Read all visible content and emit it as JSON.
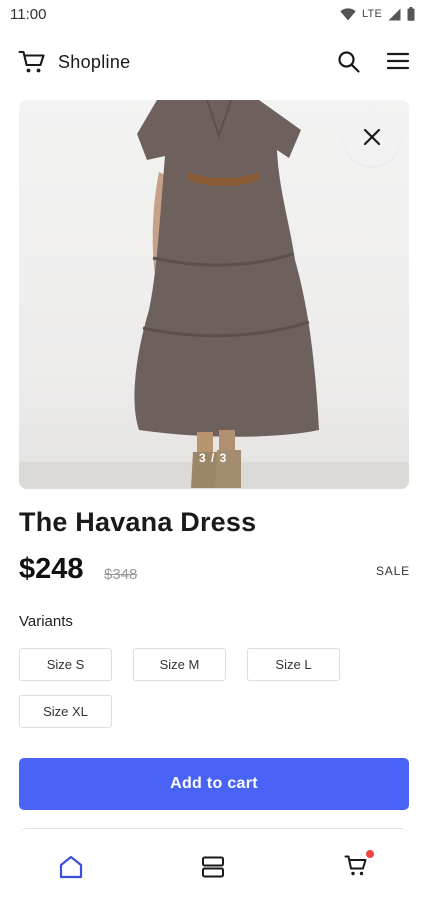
{
  "status_bar": {
    "time": "11:00",
    "network": "LTE"
  },
  "header": {
    "brand": "Shopline",
    "logo_icon": "cart-icon",
    "search_icon": "search-icon",
    "menu_icon": "menu-icon"
  },
  "gallery": {
    "counter": "3 / 3",
    "close_icon": "close-icon"
  },
  "product": {
    "title": "The Havana Dress",
    "price": "$248",
    "compare_at_price": "$348",
    "badge": "SALE"
  },
  "variants": {
    "label": "Variants",
    "options": [
      "Size S",
      "Size M",
      "Size L",
      "Size XL"
    ]
  },
  "actions": {
    "add_to_cart": "Add to cart"
  },
  "bottom_nav": {
    "items": [
      {
        "icon": "home-icon",
        "active": true
      },
      {
        "icon": "categories-icon",
        "active": false
      },
      {
        "icon": "cart-icon",
        "active": false,
        "badge_dot": true
      }
    ]
  },
  "colors": {
    "accent": "#4a63f7",
    "active_nav": "#3b4fe0",
    "badge_dot": "#ef4444",
    "text": "#1a1a1a"
  }
}
